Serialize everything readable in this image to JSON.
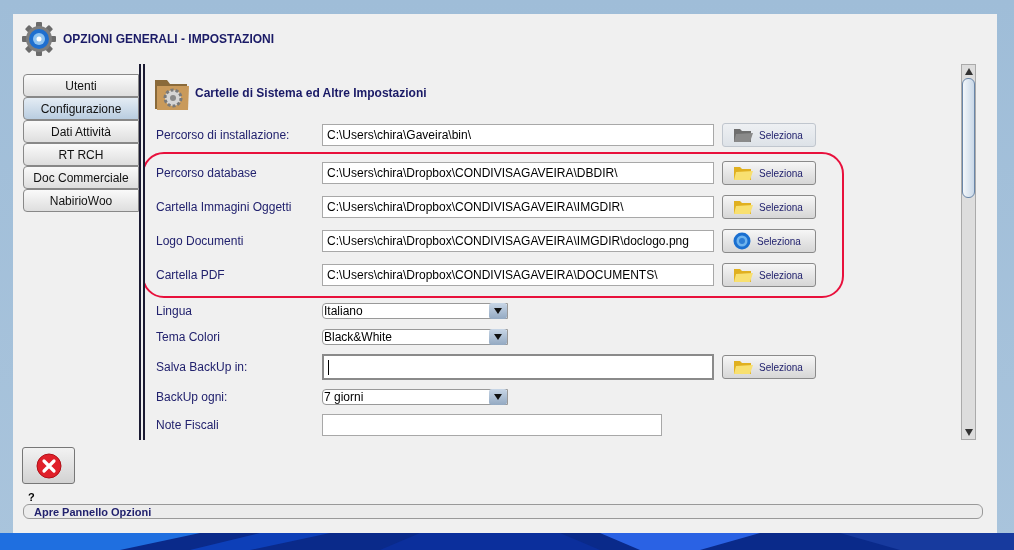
{
  "window": {
    "title": "OPZIONI GENERALI - IMPOSTAZIONI"
  },
  "tabs": [
    {
      "label": "Utenti",
      "selected": false
    },
    {
      "label": "Configurazione",
      "selected": true
    },
    {
      "label": "Dati Attività",
      "selected": false
    },
    {
      "label": "RT RCH",
      "selected": false
    },
    {
      "label": "Doc Commerciale",
      "selected": false
    },
    {
      "label": "NabirioWoo",
      "selected": false
    }
  ],
  "section": {
    "title": "Cartelle di Sistema ed Altre Impostazioni"
  },
  "groups": [
    {
      "highlighted": false,
      "rows": [
        {
          "kind": "path",
          "label": "Percorso di installazione:",
          "value": "C:\\Users\\chira\\Gaveira\\bin\\",
          "button": {
            "label": "Seleziona",
            "kind": "folder",
            "disabled": true
          }
        }
      ]
    },
    {
      "highlighted": true,
      "rows": [
        {
          "kind": "path",
          "label": "Percorso database",
          "value": "C:\\Users\\chira\\Dropbox\\CONDIVISAGAVEIRA\\DBDIR\\",
          "button": {
            "label": "Seleziona",
            "kind": "folder",
            "disabled": false
          }
        },
        {
          "kind": "path",
          "label": "Cartella Immagini Oggetti",
          "value": "C:\\Users\\chira\\Dropbox\\CONDIVISAGAVEIRA\\IMGDIR\\",
          "button": {
            "label": "Seleziona",
            "kind": "folder",
            "disabled": false
          }
        },
        {
          "kind": "path",
          "label": "Logo Documenti",
          "value": "C:\\Users\\chira\\Dropbox\\CONDIVISAGAVEIRA\\IMGDIR\\doclogo.png",
          "button": {
            "label": "Seleziona",
            "kind": "file",
            "disabled": false
          }
        },
        {
          "kind": "path",
          "label": "Cartella PDF",
          "value": "C:\\Users\\chira\\Dropbox\\CONDIVISAGAVEIRA\\DOCUMENTS\\",
          "button": {
            "label": "Seleziona",
            "kind": "folder",
            "disabled": false
          }
        }
      ]
    },
    {
      "highlighted": false,
      "rows": [
        {
          "kind": "select",
          "label": "Lingua",
          "value": "Italiano"
        },
        {
          "kind": "select",
          "label": "Tema Colori",
          "value": "Black&White"
        },
        {
          "kind": "path",
          "label": "Salva BackUp in:",
          "focused": true,
          "button": {
            "label": "Seleziona",
            "kind": "folder",
            "disabled": false
          }
        },
        {
          "kind": "select",
          "label": "BackUp ogni:",
          "value": "7 giorni"
        },
        {
          "kind": "field",
          "label": "Note Fiscali"
        }
      ]
    }
  ],
  "help": {
    "mark": "?"
  },
  "status_bar": {
    "text": "Apre Pannello Opzioni"
  }
}
